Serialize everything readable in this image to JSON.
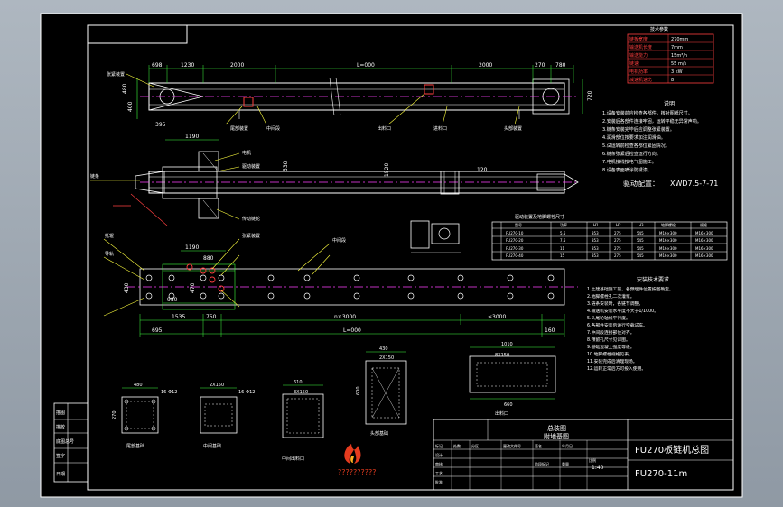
{
  "title_block": {
    "drawing_name": "FU270板链机总图",
    "drawing_no": "FU270-11m",
    "view_title_1": "总装图",
    "view_title_2": "附地基图",
    "scale": "1:40",
    "logo_caption": "??????????"
  },
  "tech_params": {
    "header": "技术参数",
    "rows": [
      {
        "label": "链板宽度",
        "value": "270mm"
      },
      {
        "label": "输送机长度",
        "value": "7mm"
      },
      {
        "label": "输送能力",
        "value": "15m³/h"
      },
      {
        "label": "链速",
        "value": "55 m/s"
      },
      {
        "label": "电机功率",
        "value": "3 kW"
      },
      {
        "label": "减速机速比",
        "value": "8"
      }
    ]
  },
  "notes": {
    "header": "说明",
    "lines": [
      "1.设备安装前应检查各部件，核对图纸尺寸。",
      "2.安装后各部件连接牢固，运转平稳无异常声响。",
      "3.链条安装完毕后应调整张紧装置。",
      "4.润滑部位按要求加注润滑油。",
      "5.试运转前检查各部位紧固情况。",
      "6.链条张紧后检查运行方向。",
      "7.电机接线按电气图施工。",
      "8.设备表面喷涂防锈漆。"
    ],
    "drive_label": "驱动配置：",
    "drive_value": "XWD7.5-7-71"
  },
  "drive_table": {
    "title": "驱动装置及地脚螺栓尺寸",
    "headers": [
      "型号",
      "功率",
      "H1",
      "H2",
      "H3",
      "地脚螺栓",
      "规格"
    ],
    "rows": [
      [
        "FU270-10",
        "5.5",
        "353",
        "275",
        "545",
        "M16×300",
        "M16×300"
      ],
      [
        "FU270-20",
        "7.5",
        "353",
        "275",
        "545",
        "M16×300",
        "M16×300"
      ],
      [
        "FU270-30",
        "11",
        "353",
        "275",
        "545",
        "M16×300",
        "M16×300"
      ],
      [
        "FU270-40",
        "15",
        "353",
        "275",
        "545",
        "M16×300",
        "M16×300"
      ]
    ]
  },
  "install_notes": {
    "header": "安装技术要求",
    "lines": [
      "1.土建基础施工前，各预埋件位置按图确定。",
      "2.地脚螺栓孔二次灌浆。",
      "3.链条安装时，各链节调整。",
      "4.输送机安装水平度不大于1/1000。",
      "5.头尾轮轴线平行度。",
      "6.各部件安装后进行空载试车。",
      "7.中间段连接部位对齐。",
      "8.预留孔尺寸见详图。",
      "9.基础混凝土强度等级。",
      "10.地脚螺栓规格见表。",
      "11.安装完成后清理现场。",
      "12.运转正常后方可投入使用。"
    ]
  },
  "callouts": [
    "驱动装置",
    "尾部装置",
    "中间段",
    "头部装置",
    "张紧装置",
    "出料口",
    "进料口",
    "传动链轮",
    "链条",
    "托辊",
    "导轨",
    "电机"
  ],
  "dimensions": {
    "top_row": [
      "698",
      "1230",
      "2000",
      "L=000",
      "2000",
      "270",
      "780"
    ],
    "side_left": [
      "480",
      "400",
      "395"
    ],
    "side_right": [
      "1100",
      "720"
    ],
    "mid_labels": [
      "1190",
      "530",
      "1520",
      "120"
    ],
    "plan_bottom": [
      "1535",
      "750",
      "n×3000",
      "≤3000",
      "160",
      "695",
      "980"
    ],
    "plan_total": "L=000",
    "plan_widths": [
      "1190",
      "880",
      "430",
      "470"
    ]
  },
  "section_views": [
    {
      "title": "尾部基础",
      "w": "480",
      "h": "270",
      "dim": "16-Φ12"
    },
    {
      "title": "中间基础",
      "w": "430",
      "h": "270",
      "dim": "2X150"
    },
    {
      "title": "中间出料口",
      "w": "610",
      "h": "430",
      "dim": "3X150"
    },
    {
      "title": "头部基础",
      "w": "430",
      "h": "600",
      "dim": "2X150"
    },
    {
      "title": "出料口",
      "w": "1010",
      "h": "660",
      "dim": "8X150"
    }
  ],
  "title_block_cells": [
    "标记",
    "处数",
    "分区",
    "更改文件号",
    "签名",
    "年月日",
    "设计",
    "审核",
    "工艺",
    "批准",
    "阶段标记",
    "重量",
    "比例"
  ],
  "left_stamp": [
    "描图",
    "描校",
    "底图总号",
    "签字",
    "日期"
  ],
  "colors": {
    "paper": "#000000",
    "frame": "#ffffff",
    "equipment": "#ffffff",
    "centerline": "#ff3fff",
    "dimension": "#3fff3f",
    "annotation": "#ffff3f",
    "section_red": "#ff3f3f",
    "ring": "#ffffff"
  }
}
